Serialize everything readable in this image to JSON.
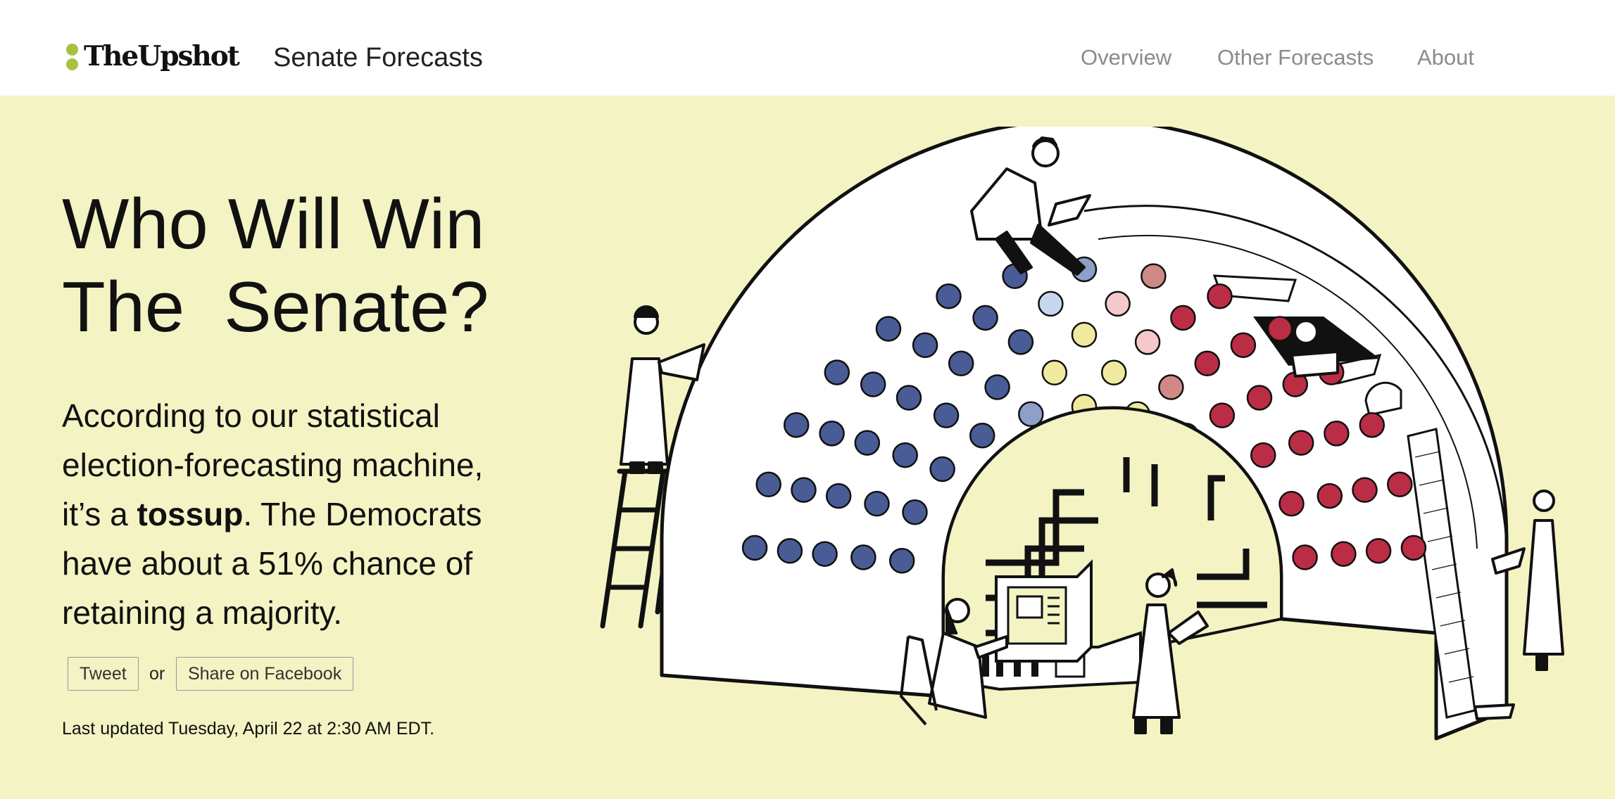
{
  "header": {
    "logo_text": "TheUpshot",
    "section_title": "Senate Forecasts",
    "nav": [
      {
        "label": "Overview"
      },
      {
        "label": "Other Forecasts"
      },
      {
        "label": "About"
      }
    ]
  },
  "main": {
    "headline_line1": "Who Will Win",
    "headline_line2": "The  Senate?",
    "intro": {
      "part1": "According to our statistical election-forecasting machine, it’s a ",
      "bold": "tossup",
      "part2": ". The Democrats have about a 51% chance of retaining a majority."
    },
    "share": {
      "tweet_label": "Tweet",
      "or_label": "or",
      "facebook_label": "Share on Facebook"
    },
    "last_updated": "Last updated Tuesday, April 22 at 2:30 AM EDT."
  },
  "illustration": {
    "subject": "senate-dome-forecasting-machine",
    "colors": {
      "dem": "#4a5c95",
      "dem_light": "#8e9fc8",
      "dem_pale": "#c7d7ee",
      "toss": "#f0eaa0",
      "rep_pale": "#f5c8cc",
      "rep_light": "#cf8a86",
      "rep": "#bb2d44",
      "ink": "#111111",
      "background": "#f3f3c4"
    },
    "seat_rows": [
      [
        "dem",
        "dem",
        "dem",
        "dem",
        "dem_light",
        "toss",
        "toss",
        "rep_light",
        "rep",
        "rep",
        "rep"
      ],
      [
        "dem",
        "dem",
        "dem",
        "dem",
        "dem",
        "toss",
        "toss",
        "rep_light",
        "rep",
        "rep",
        "rep",
        "rep"
      ],
      [
        "dem",
        "dem",
        "dem",
        "dem",
        "dem",
        "dem",
        "toss",
        "rep_pale",
        "rep",
        "rep",
        "rep",
        "rep",
        "rep"
      ],
      [
        "dem",
        "dem",
        "dem",
        "dem",
        "dem",
        "dem",
        "dem_pale",
        "rep_pale",
        "rep",
        "rep",
        "rep",
        "rep",
        "rep",
        "rep"
      ],
      [
        "dem",
        "dem",
        "dem",
        "dem",
        "dem",
        "dem",
        "dem",
        "dem_light",
        "rep_light",
        "rep",
        "rep",
        "rep",
        "rep",
        "rep",
        "rep"
      ]
    ]
  }
}
